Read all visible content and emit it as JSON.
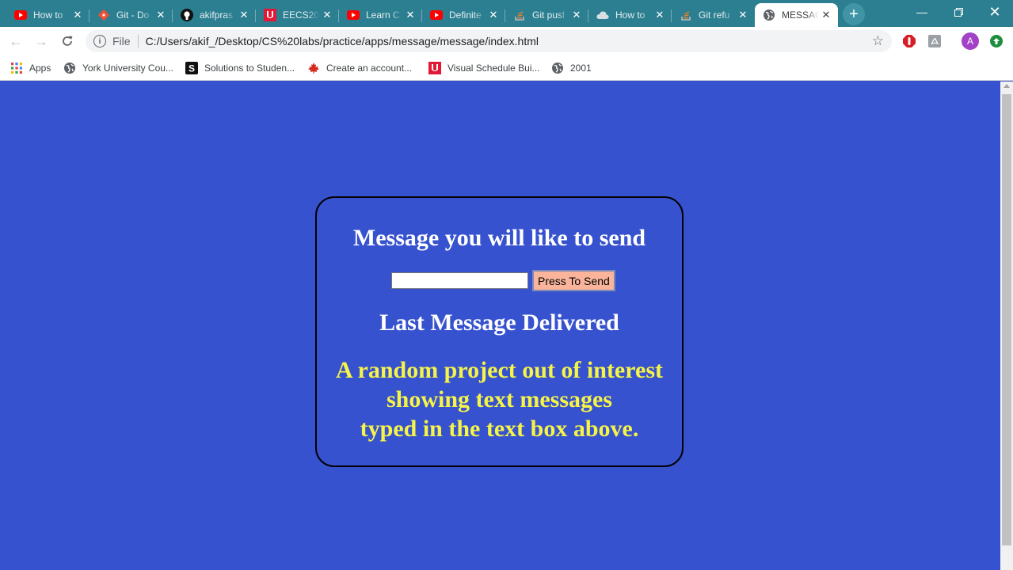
{
  "tabs": [
    {
      "title": "How to",
      "icon": "youtube-icon"
    },
    {
      "title": "Git - Do",
      "icon": "git-icon"
    },
    {
      "title": "akifpras",
      "icon": "github-icon"
    },
    {
      "title": "EECS20",
      "icon": "york-u-icon"
    },
    {
      "title": "Learn C",
      "icon": "youtube-icon"
    },
    {
      "title": "Definite",
      "icon": "youtube-icon"
    },
    {
      "title": "Git pusl",
      "icon": "stackoverflow-icon"
    },
    {
      "title": "How to",
      "icon": "cloud-icon"
    },
    {
      "title": "Git refu",
      "icon": "stackoverflow-icon"
    },
    {
      "title": "MESSAG",
      "icon": "globe-icon",
      "active": true
    }
  ],
  "toolbar": {
    "scheme": "File",
    "url": "C:/Users/akif_/Desktop/CS%20labs/practice/apps/message/message/index.html"
  },
  "bookmarks": [
    {
      "label": "Apps",
      "icon": "apps-grid-icon"
    },
    {
      "label": "York University Cou...",
      "icon": "globe-icon"
    },
    {
      "label": "Solutions to Studen...",
      "icon": "s-logo-icon"
    },
    {
      "label": "Create an account...",
      "icon": "maple-leaf-icon"
    },
    {
      "label": "Visual Schedule Bui...",
      "icon": "york-u-icon"
    },
    {
      "label": "2001",
      "icon": "globe-icon"
    }
  ],
  "profile": {
    "initial": "A"
  },
  "page": {
    "heading": "Message you will like to send",
    "input_value": "",
    "send_label": "Press To Send",
    "last_heading": "Last Message Delivered",
    "last_message_lines": [
      "A random project out of interest",
      "showing text messages",
      "typed in the text box above."
    ]
  },
  "colors": {
    "page_background": "#3752cf",
    "message_text": "#f6f447",
    "button_background": "#f9b49b",
    "tabstrip": "#2c7f91"
  }
}
